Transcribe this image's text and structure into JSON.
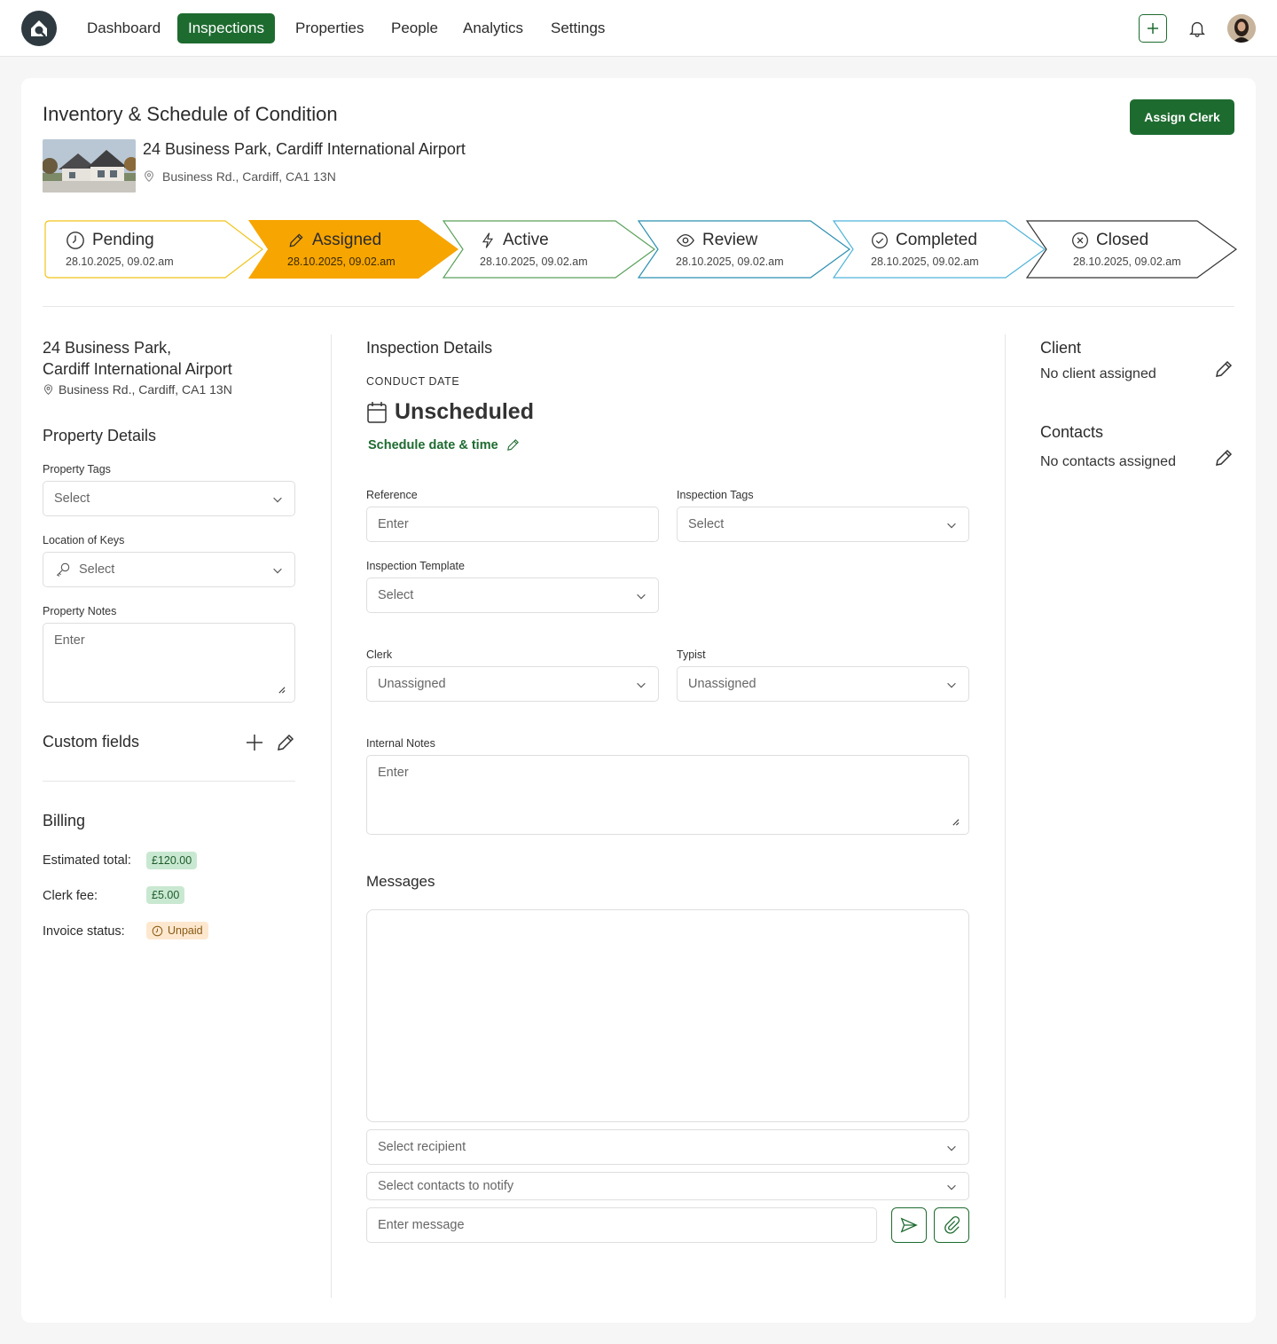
{
  "nav": {
    "items": [
      "Dashboard",
      "Inspections",
      "Properties",
      "People",
      "Analytics",
      "Settings"
    ],
    "active": "Inspections"
  },
  "header": {
    "title": "Inventory & Schedule of Condition",
    "assign_button": "Assign Clerk",
    "property_name": "24 Business Park, Cardiff International Airport",
    "property_address": "Business Rd., Cardiff, CA1 13N"
  },
  "stages": [
    {
      "label": "Pending",
      "date": "28.10.2025, 09.02.am",
      "icon": "clock-icon",
      "color": "#f0c419"
    },
    {
      "label": "Assigned",
      "date": "28.10.2025, 09.02.am",
      "icon": "pencil-icon",
      "color": "#f7a500"
    },
    {
      "label": "Active",
      "date": "28.10.2025, 09.02.am",
      "icon": "lightning-icon",
      "color": "#5aa05a"
    },
    {
      "label": "Review",
      "date": "28.10.2025, 09.02.am",
      "icon": "eye-icon",
      "color": "#2a8fb0"
    },
    {
      "label": "Completed",
      "date": "28.10.2025, 09.02.am",
      "icon": "check-circle-icon",
      "color": "#4fb3d9"
    },
    {
      "label": "Closed",
      "date": "28.10.2025, 09.02.am",
      "icon": "x-circle-icon",
      "color": "#333333"
    }
  ],
  "left": {
    "property_name_line1": "24 Business Park,",
    "property_name_line2": "Cardiff International Airport",
    "property_address": "Business Rd., Cardiff, CA1 13N",
    "property_details_title": "Property Details",
    "property_tags_label": "Property Tags",
    "property_tags_value": "Select",
    "location_keys_label": "Location of Keys",
    "location_keys_value": "Select",
    "property_notes_label": "Property Notes",
    "property_notes_placeholder": "Enter",
    "custom_fields_title": "Custom fields",
    "billing_title": "Billing",
    "estimated_total_label": "Estimated total:",
    "estimated_total_value": "£120.00",
    "clerk_fee_label": "Clerk fee:",
    "clerk_fee_value": "£5.00",
    "invoice_status_label": "Invoice status:",
    "invoice_status_value": "Unpaid"
  },
  "middle": {
    "title": "Inspection Details",
    "conduct_date_label": "CONDUCT DATE",
    "conduct_date_value": "Unscheduled",
    "schedule_link": "Schedule date & time",
    "reference_label": "Reference",
    "reference_placeholder": "Enter",
    "inspection_tags_label": "Inspection Tags",
    "inspection_tags_value": "Select",
    "template_label": "Inspection Template",
    "template_value": "Select",
    "clerk_label": "Clerk",
    "clerk_value": "Unassigned",
    "typist_label": "Typist",
    "typist_value": "Unassigned",
    "internal_notes_label": "Internal Notes",
    "internal_notes_placeholder": "Enter",
    "messages_title": "Messages",
    "recipient_placeholder": "Select recipient",
    "contacts_placeholder": "Select contacts to notify",
    "message_placeholder": "Enter message"
  },
  "right": {
    "client_title": "Client",
    "client_value": "No client assigned",
    "contacts_title": "Contacts",
    "contacts_value": "No contacts assigned"
  },
  "colors": {
    "brand": "#1e6b30",
    "assigned": "#f7a500"
  }
}
